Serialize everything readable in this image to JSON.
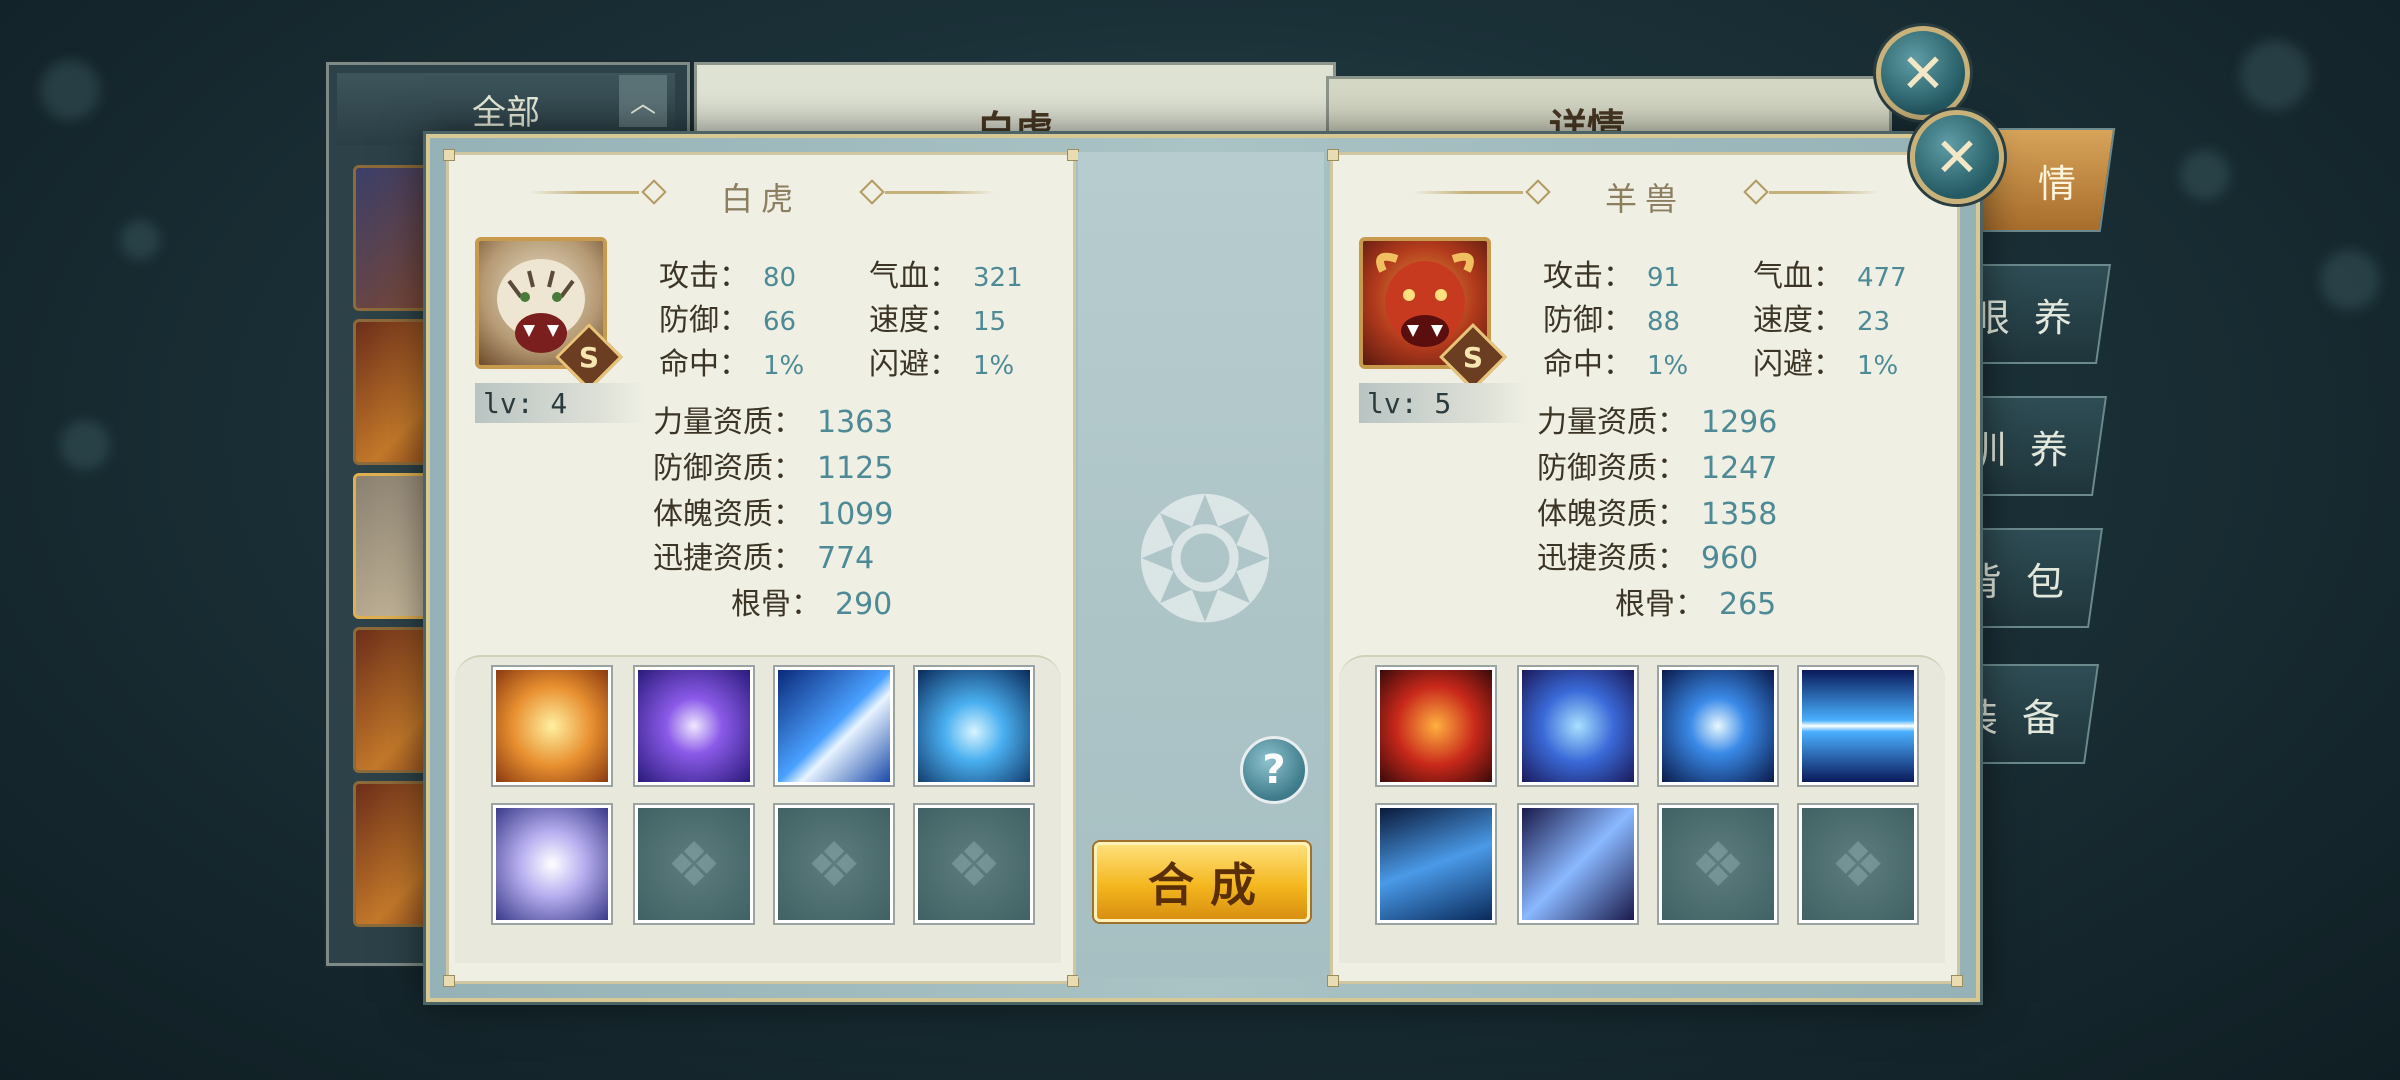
{
  "background": {
    "list_header": "全部",
    "detail_title": "白虎",
    "right_title": "详情",
    "side_tabs": [
      "情",
      "眼 养",
      "训 养",
      "背 包",
      "装 备"
    ]
  },
  "modal": {
    "left": {
      "name": "白虎",
      "level": "lv: 4",
      "grade": "S",
      "stats": [
        {
          "label": "攻击：",
          "value": "80"
        },
        {
          "label": "气血：",
          "value": "321"
        },
        {
          "label": "防御：",
          "value": "66"
        },
        {
          "label": "速度：",
          "value": "15"
        },
        {
          "label": "命中：",
          "value": "1%"
        },
        {
          "label": "闪避：",
          "value": "1%"
        }
      ],
      "aptitudes": [
        {
          "label": "力量资质：",
          "value": "1363"
        },
        {
          "label": "防御资质：",
          "value": "1125"
        },
        {
          "label": "体魄资质：",
          "value": "1099"
        },
        {
          "label": "迅捷资质：",
          "value": "774"
        },
        {
          "label": "根骨：",
          "value": "290"
        }
      ],
      "skills": [
        "tiger-roar-skill-icon",
        "purple-orb-skill-icon",
        "lightning-dash-skill-icon",
        "blue-heart-skill-icon",
        "whirlwind-skill-icon",
        "empty",
        "empty",
        "empty"
      ]
    },
    "right": {
      "name": "羊兽",
      "level": "lv: 5",
      "grade": "S",
      "stats": [
        {
          "label": "攻击：",
          "value": "91"
        },
        {
          "label": "气血：",
          "value": "477"
        },
        {
          "label": "防御：",
          "value": "88"
        },
        {
          "label": "速度：",
          "value": "23"
        },
        {
          "label": "命中：",
          "value": "1%"
        },
        {
          "label": "闪避：",
          "value": "1%"
        }
      ],
      "aptitudes": [
        {
          "label": "力量资质：",
          "value": "1296"
        },
        {
          "label": "防御资质：",
          "value": "1247"
        },
        {
          "label": "体魄资质：",
          "value": "1358"
        },
        {
          "label": "迅捷资质：",
          "value": "960"
        },
        {
          "label": "根骨：",
          "value": "265"
        }
      ],
      "skills": [
        "fire-orb-skill-icon",
        "shield-skill-icon",
        "vortex-skill-icon",
        "speed-lines-skill-icon",
        "ice-spikes-skill-icon",
        "claw-slash-skill-icon",
        "empty",
        "empty"
      ]
    },
    "help_label": "?",
    "compose_label": "合成"
  }
}
